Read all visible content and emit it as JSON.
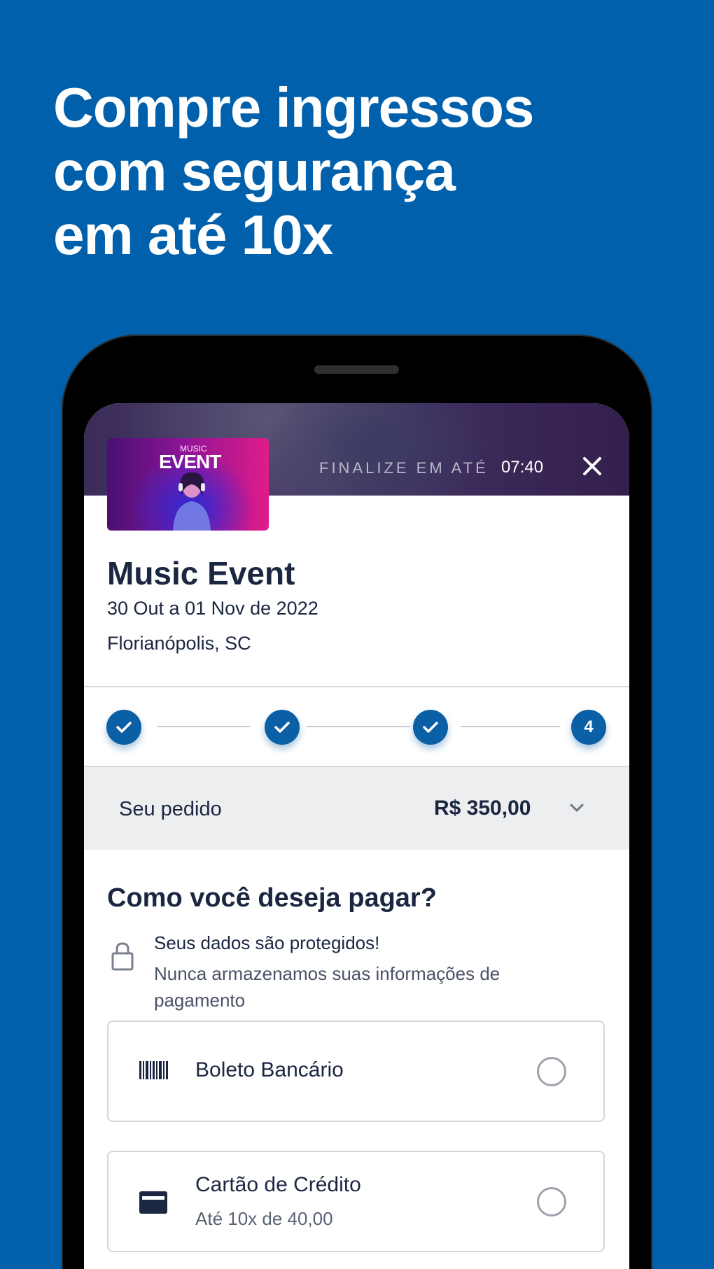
{
  "promo": {
    "headline_line1": "Compre ingressos",
    "headline_line2": "com segurança",
    "headline_line3": "em até 10x"
  },
  "event": {
    "thumb_small": "MUSIC",
    "thumb_big": "EVENT",
    "finalize_label": "FINALIZE EM ATÉ",
    "timer": "07:40",
    "title": "Music Event",
    "date": "30 Out a 01 Nov de 2022",
    "place": "Florianópolis, SC"
  },
  "stepper": {
    "steps": [
      "done",
      "done",
      "done",
      "4"
    ],
    "current_step": "4"
  },
  "order": {
    "label": "Seu pedido",
    "total": "R$ 350,00"
  },
  "payment": {
    "title": "Como você deseja pagar?",
    "secure_title": "Seus dados são protegidos!",
    "secure_text": "Nunca armazenamos suas informações de pagamento",
    "options": [
      {
        "label": "Boleto Bancário",
        "icon": "barcode-icon",
        "selected": false
      },
      {
        "label": "Cartão de Crédito",
        "sub": "Até 10x de 40,00",
        "icon": "credit-card-icon",
        "selected": false
      }
    ]
  },
  "colors": {
    "background": "#0060ab",
    "primary": "#0b5fa5",
    "text": "#1b2640"
  }
}
